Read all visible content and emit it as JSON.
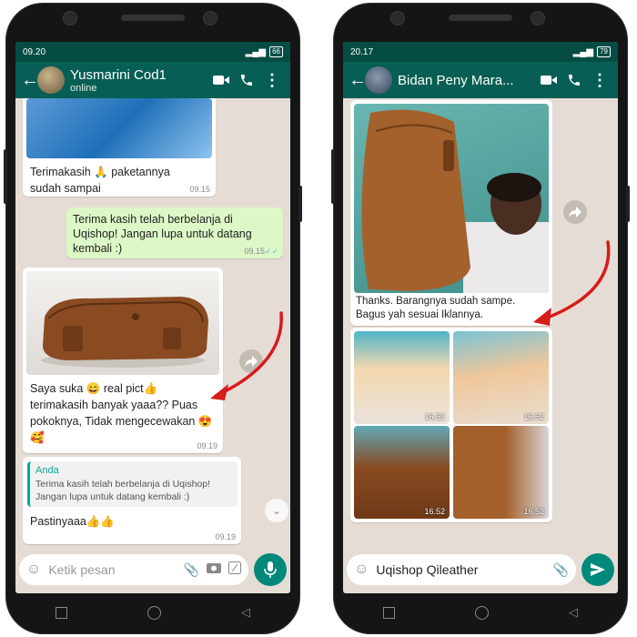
{
  "left_phone": {
    "status": {
      "time": "09.20",
      "battery": "66"
    },
    "contact": {
      "name": "Yusmarini Cod1",
      "status": "online"
    },
    "messages": {
      "m1_text": "Terimakasih 🙏 paketannya sudah sampai",
      "m1_time": "09.15",
      "m2_text": "Terima kasih telah berbelanja di Uqishop! Jangan lupa untuk datang kembali :)",
      "m2_time": "09.15",
      "m3_text": "Saya suka 😄 real pict👍 terimakasih banyak yaaa?? Puas pokoknya, Tidak mengecewakan 😍🥰",
      "m3_time": "09.19",
      "m4_quote_author": "Anda",
      "m4_quote_text": "Terima kasih telah berbelanja di Uqishop! Jangan lupa untuk datang kembali :)",
      "m4_text": "Pastinyaaa👍👍",
      "m4_time": "09.19"
    },
    "input_placeholder": "Ketik pesan"
  },
  "right_phone": {
    "status": {
      "time": "20.17",
      "battery": "79"
    },
    "contact": {
      "name": "Bidan Peny Mara..."
    },
    "messages": {
      "m1_text": "Thanks. Barangnya sudah sampe. Bagus yah sesuai Iklannya.",
      "thumb_times": [
        "16.52",
        "16.52",
        "16.52",
        "16.52"
      ]
    },
    "input_text": "Uqishop Qileather"
  },
  "colors": {
    "header": "#075e54",
    "statusbar": "#054d44",
    "outgoing": "#dcf8c6",
    "accent": "#00897b",
    "arrow": "#d81b1b"
  }
}
